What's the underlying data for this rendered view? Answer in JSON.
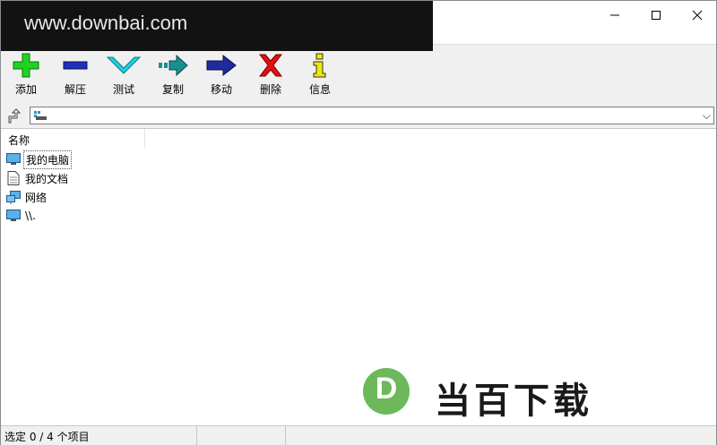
{
  "watermark": {
    "text": "www.downbai.com"
  },
  "window_controls": {
    "minimize": "—",
    "maximize": "☐",
    "close": "✕"
  },
  "toolbar": {
    "buttons": [
      {
        "label": "添加",
        "icon": "add-icon",
        "color": "#22cc22"
      },
      {
        "label": "解压",
        "icon": "extract-icon",
        "color": "#1f2fb8"
      },
      {
        "label": "测试",
        "icon": "test-check-icon",
        "color": "#1ec8d8"
      },
      {
        "label": "复制",
        "icon": "copy-arrow-icon",
        "color": "#1a8f8f"
      },
      {
        "label": "移动",
        "icon": "move-arrow-icon",
        "color": "#1f2a9c"
      },
      {
        "label": "删除",
        "icon": "delete-x-icon",
        "color": "#e01010"
      },
      {
        "label": "信息",
        "icon": "info-icon",
        "color": "#e8e000"
      }
    ]
  },
  "address": {
    "value": "",
    "dropdown_icon": "chevron-down-icon"
  },
  "list": {
    "column_header": "名称",
    "items": [
      {
        "name": "我的电脑",
        "icon": "computer-icon"
      },
      {
        "name": "我的文档",
        "icon": "document-icon"
      },
      {
        "name": "网络",
        "icon": "network-icon"
      },
      {
        "name": "\\\\.",
        "icon": "computer-icon"
      }
    ]
  },
  "brand": {
    "logo_letter": "D",
    "text": "当百下载"
  },
  "status": {
    "selection": "选定 0 / 4 个项目"
  }
}
